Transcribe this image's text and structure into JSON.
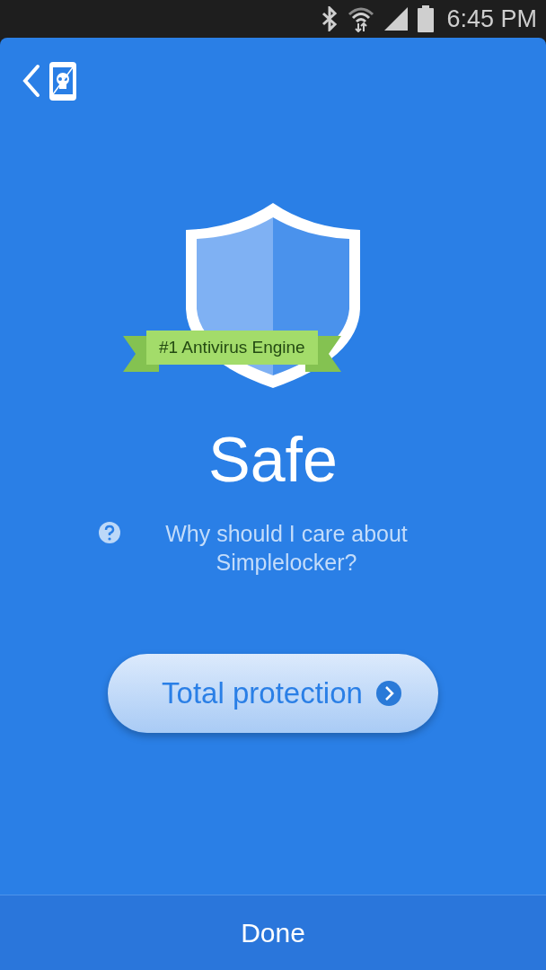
{
  "status_bar": {
    "time": "6:45 PM"
  },
  "badge": {
    "label": "#1 Antivirus Engine"
  },
  "status": {
    "title": "Safe"
  },
  "help_link": {
    "text": "Why should I care about Simplelocker?"
  },
  "primary_button": {
    "label": "Total protection"
  },
  "footer": {
    "button": "Done"
  }
}
